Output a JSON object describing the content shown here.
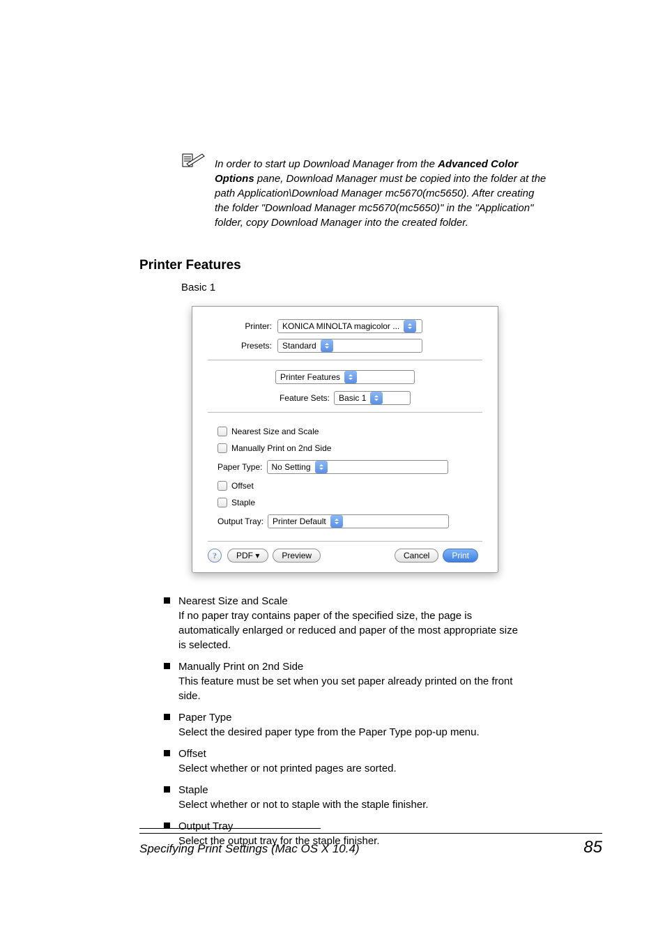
{
  "note": {
    "prefix": "In order to start up Download Manager from the ",
    "bold": "Advanced Color Options",
    "suffix": " pane, Download Manager must be copied into the folder at the path Application\\Download Manager mc5670(mc5650). After creating the folder \"Download Manager mc5670(mc5650)\" in the \"Application\" folder, copy Download Manager into the created folder."
  },
  "section": {
    "title": "Printer Features",
    "subtitle": "Basic 1"
  },
  "dialog": {
    "printer_label": "Printer:",
    "printer_value": "KONICA MINOLTA magicolor ...",
    "presets_label": "Presets:",
    "presets_value": "Standard",
    "pane_value": "Printer Features",
    "feature_sets_label": "Feature Sets:",
    "feature_sets_value": "Basic 1",
    "nearest": "Nearest Size and Scale",
    "manual2nd": "Manually Print on 2nd Side",
    "paper_type_label": "Paper Type:",
    "paper_type_value": "No Setting",
    "offset": "Offset",
    "staple": "Staple",
    "output_tray_label": "Output Tray:",
    "output_tray_value": "Printer Default",
    "help": "?",
    "pdf": "PDF ▾",
    "preview": "Preview",
    "cancel": "Cancel",
    "print": "Print"
  },
  "features": [
    {
      "title": "Nearest Size and Scale",
      "desc": "If no paper tray contains paper of the specified size, the page is automatically enlarged or reduced and paper of the most appropriate size is selected."
    },
    {
      "title": "Manually Print on 2nd Side",
      "desc": "This feature must be set when you set paper already printed on the front side."
    },
    {
      "title": "Paper Type",
      "desc": "Select the desired paper type from the Paper Type pop-up menu."
    },
    {
      "title": "Offset",
      "desc": "Select whether or not printed pages are sorted."
    },
    {
      "title": "Staple",
      "desc": "Select whether or not to staple with the staple finisher."
    },
    {
      "title": "Output Tray",
      "desc": "Select the output tray for the staple finisher."
    }
  ],
  "footer": {
    "left": "Specifying Print Settings (Mac OS X 10.4)",
    "page": "85"
  }
}
